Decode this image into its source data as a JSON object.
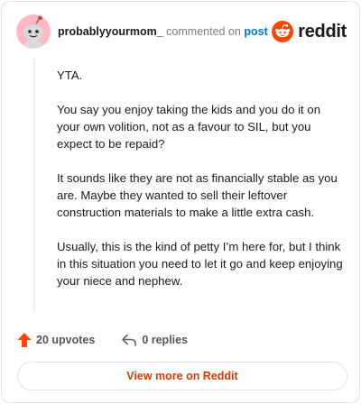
{
  "header": {
    "username": "probablyyourmom_",
    "commented_text": "commented on",
    "post_link": "post",
    "avatar_icon": "snoo-avatar-icon",
    "brand_icon": "reddit-logo-icon",
    "brand_name": "reddit"
  },
  "comment": {
    "paragraphs": [
      "YTA.",
      "You say you enjoy taking the kids and you do it on your own volition, not as a favour to SIL, but you expect to be repaid?",
      "It sounds like they are not as financially stable as you are. Maybe they wanted to sell their leftover construction materials to make a little extra cash.",
      "Usually, this is the kind of petty I’m here for, but I think in this situation you need to let it go and keep enjoying your niece and nephew."
    ]
  },
  "actions": {
    "upvotes_label": "20 upvotes",
    "upvote_icon": "upvote-arrow-icon",
    "replies_label": "0 replies",
    "reply_icon": "reply-arrow-icon"
  },
  "footer": {
    "view_more_label": "View more on Reddit"
  },
  "colors": {
    "accent_orange": "#ff4500",
    "link_blue": "#0079d3",
    "button_text": "#d93a00",
    "avatar_bg": "#ffb8c4"
  }
}
